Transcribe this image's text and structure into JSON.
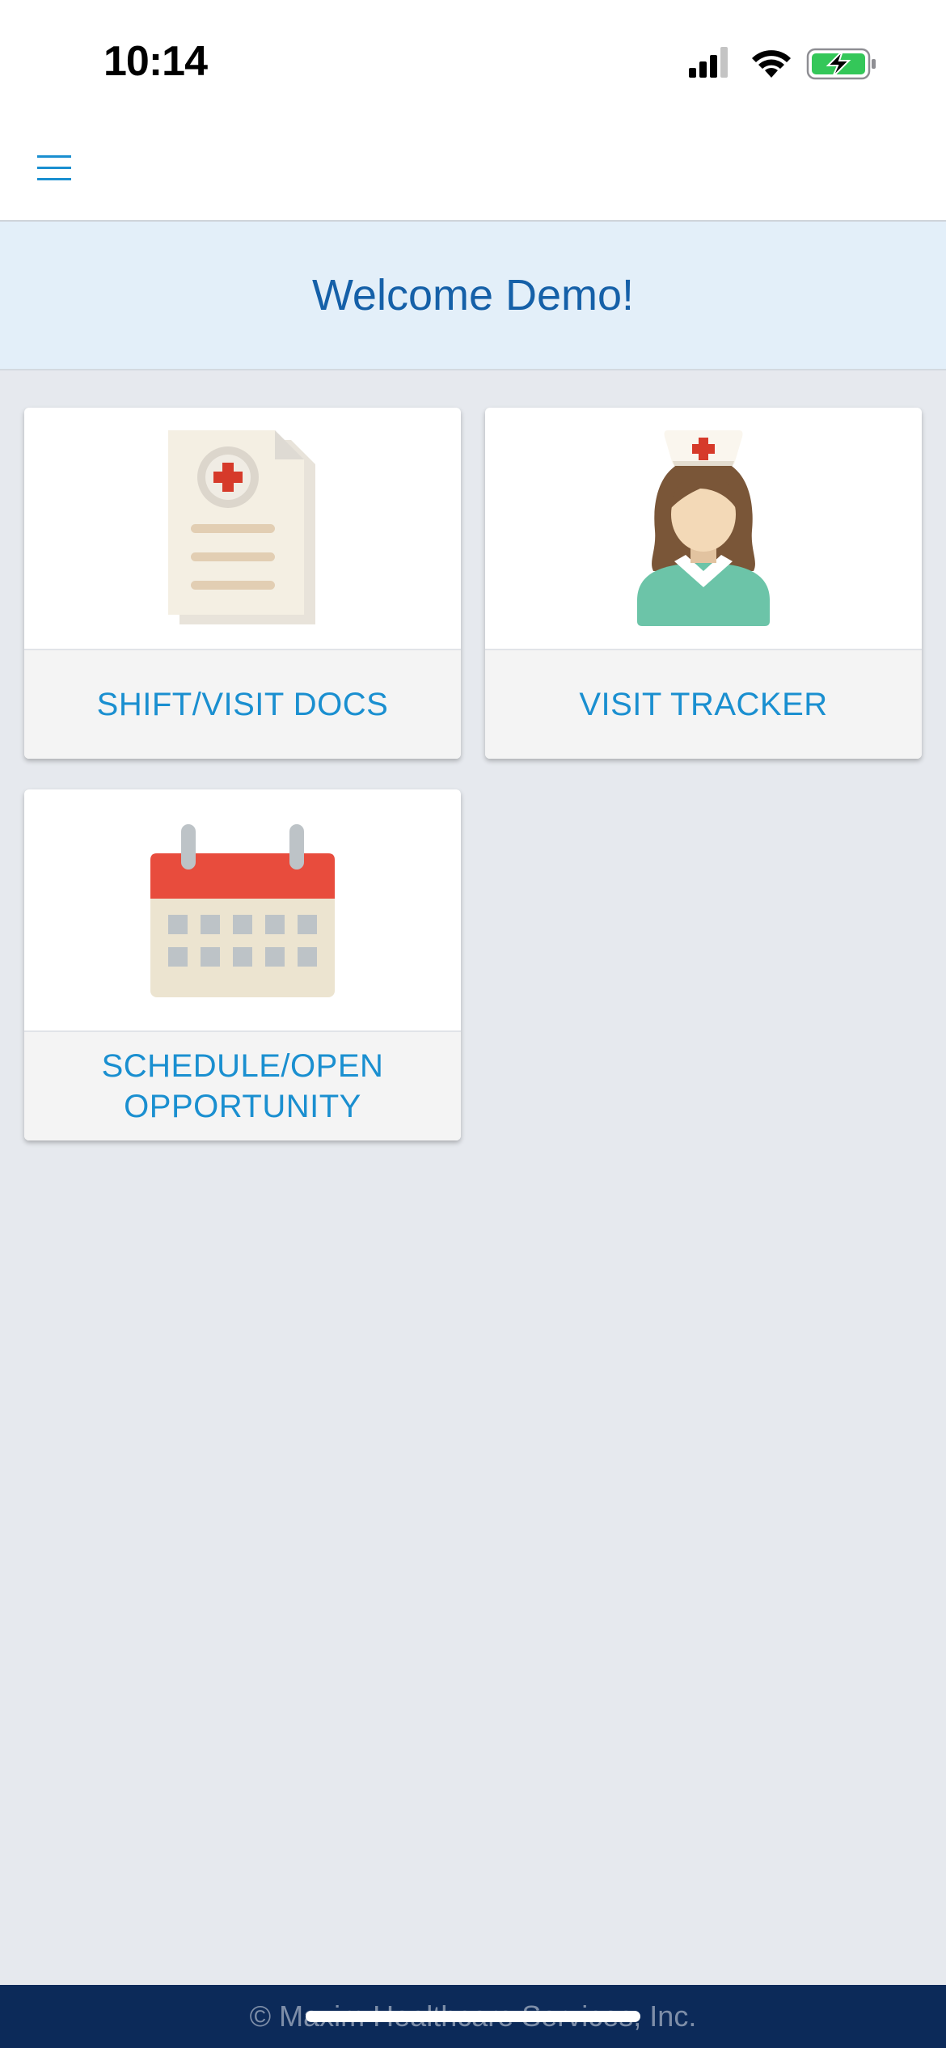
{
  "status_bar": {
    "time": "10:14",
    "icons": [
      "cellular-signal-icon",
      "wifi-icon",
      "battery-charging-icon"
    ]
  },
  "navbar": {
    "menu_icon": "hamburger-menu-icon"
  },
  "welcome": {
    "text": "Welcome Demo!"
  },
  "tiles": [
    {
      "label": "SHIFT/VISIT DOCS",
      "icon": "medical-document-icon"
    },
    {
      "label": "VISIT TRACKER",
      "icon": "nurse-icon"
    },
    {
      "label": "SCHEDULE/OPEN\nOPPORTUNITY",
      "icon": "calendar-icon"
    }
  ],
  "footer": {
    "text": "© Maxim Healthcare Services, Inc."
  },
  "colors": {
    "accent": "#1a8fd0",
    "welcome_text": "#1560a8",
    "welcome_bg": "#e3eff9",
    "page_bg": "#e6e9ee",
    "footer_bg": "#0c2a59",
    "battery_green": "#34c759"
  }
}
